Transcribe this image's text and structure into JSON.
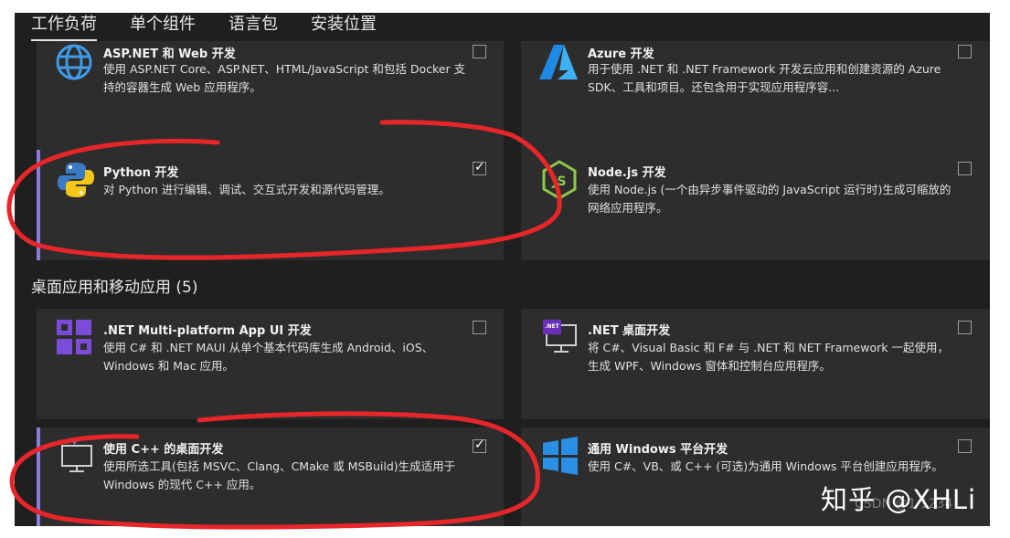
{
  "tabs": [
    "工作负荷",
    "单个组件",
    "语言包",
    "安装位置"
  ],
  "workloads_top": [
    {
      "title": "ASP.NET 和 Web 开发",
      "desc": "使用 ASP.NET Core、ASP.NET、HTML/JavaScript 和包括 Docker 支持的容器生成 Web 应用程序。",
      "checked": false,
      "icon": "globe-icon"
    },
    {
      "title": "Azure 开发",
      "desc": "用于使用 .NET 和 .NET Framework 开发云应用和创建资源的 Azure SDK、工具和项目。还包含用于实现应用程序容...",
      "checked": false,
      "icon": "azure-icon"
    },
    {
      "title": "Python 开发",
      "desc": "对 Python 进行编辑、调试、交互式开发和源代码管理。",
      "checked": true,
      "icon": "python-icon"
    },
    {
      "title": "Node.js 开发",
      "desc": "使用 Node.js (一个由异步事件驱动的 JavaScript 运行时)生成可缩放的网络应用程序。",
      "checked": false,
      "icon": "nodejs-icon"
    }
  ],
  "section_desktop": "桌面应用和移动应用 (5)",
  "workloads_desktop": [
    {
      "title": ".NET Multi-platform App UI 开发",
      "desc": "使用 C# 和 .NET MAUI 从单个基本代码库生成 Android、iOS、Windows 和 Mac 应用。",
      "checked": false,
      "icon": "maui-icon"
    },
    {
      "title": ".NET 桌面开发",
      "desc": "将 C#、Visual Basic 和 F# 与 .NET 和 NET Framework 一起使用，生成 WPF、Windows 窗体和控制台应用程序。",
      "checked": false,
      "icon": "net-desktop-icon",
      "badge": ".NET"
    },
    {
      "title": "使用 C++ 的桌面开发",
      "desc": "使用所选工具(包括 MSVC、Clang、CMake 或 MSBuild)生成适用于 Windows 的现代 C++ 应用。",
      "checked": true,
      "icon": "cpp-desktop-icon"
    },
    {
      "title": "通用 Windows 平台开发",
      "desc": "使用 C#、VB、或 C++ (可选)为通用 Windows 平台创建应用程序。",
      "checked": false,
      "icon": "windows-icon"
    }
  ],
  "watermark": {
    "zhihu": "知乎 @XHLi",
    "csdn": "CSDN @1 1234"
  },
  "colors": {
    "background": "#1f1f1f",
    "card": "#2d2d2d",
    "selected_accent": "#8b7bd8",
    "annotation": "#e8262a"
  }
}
